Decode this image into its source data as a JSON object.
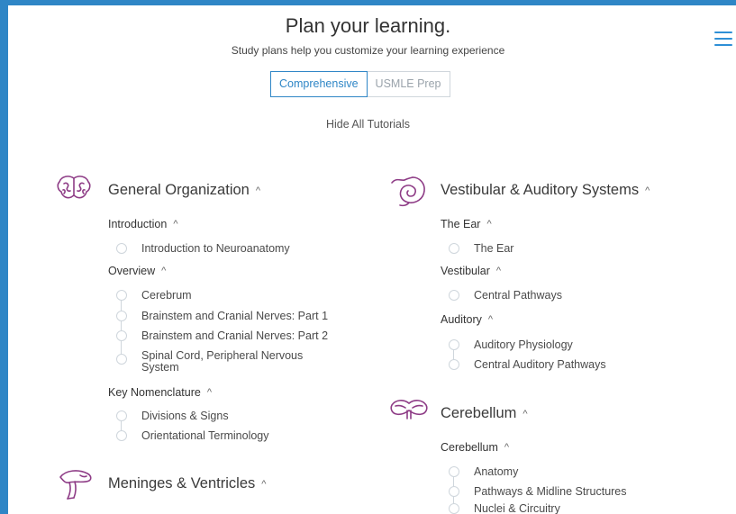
{
  "header": {
    "title": "Plan your learning.",
    "subtitle": "Study plans help you customize your learning experience",
    "tabs": [
      {
        "label": "Comprehensive",
        "active": true
      },
      {
        "label": "USMLE Prep",
        "active": false
      }
    ],
    "hide_all": "Hide All Tutorials"
  },
  "chevron": "^",
  "accent_color": "#2f86c6",
  "icon_color": "#8e3c86",
  "left": {
    "general": {
      "title": "General Organization",
      "icon": "brain-icon",
      "groups": [
        {
          "title": "Introduction",
          "lessons": [
            "Introduction to Neuroanatomy"
          ]
        },
        {
          "title": "Overview",
          "lessons": [
            "Cerebrum",
            "Brainstem and Cranial Nerves: Part 1",
            "Brainstem and Cranial Nerves: Part 2",
            "Spinal Cord, Peripheral Nervous",
            "System"
          ]
        },
        {
          "title": "Key Nomenclature",
          "lessons": [
            "Divisions & Signs",
            "Orientational Terminology"
          ]
        }
      ]
    },
    "meninges": {
      "title": "Meninges & Ventricles",
      "icon": "ventricles-icon"
    }
  },
  "right": {
    "vestibular": {
      "title": "Vestibular & Auditory Systems",
      "icon": "ear-icon",
      "groups": [
        {
          "title": "The Ear",
          "lessons": [
            "The Ear"
          ]
        },
        {
          "title": "Vestibular",
          "lessons": [
            "Central Pathways"
          ]
        },
        {
          "title": "Auditory",
          "lessons": [
            "Auditory Physiology",
            "Central Auditory Pathways"
          ]
        }
      ]
    },
    "cerebellum": {
      "title": "Cerebellum",
      "icon": "cerebellum-icon",
      "groups": [
        {
          "title": "Cerebellum",
          "lessons": [
            "Anatomy",
            "Pathways & Midline Structures",
            "Nuclei & Circuitry"
          ]
        }
      ]
    }
  }
}
